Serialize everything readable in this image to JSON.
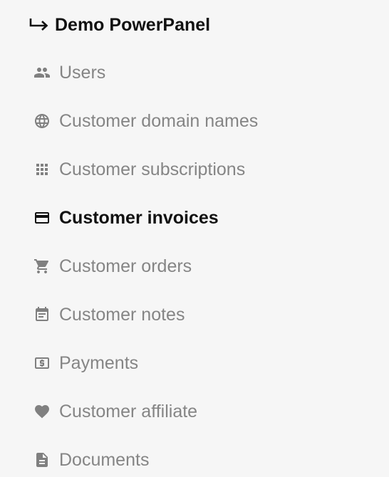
{
  "header": {
    "title": "Demo PowerPanel",
    "icon": "arrow-return-right-icon"
  },
  "nav": {
    "items": [
      {
        "label": "Users",
        "icon": "users-icon",
        "active": false
      },
      {
        "label": "Customer domain names",
        "icon": "globe-icon",
        "active": false
      },
      {
        "label": "Customer subscriptions",
        "icon": "grid-icon",
        "active": false
      },
      {
        "label": "Customer invoices",
        "icon": "credit-card-icon",
        "active": true
      },
      {
        "label": "Customer orders",
        "icon": "cart-icon",
        "active": false
      },
      {
        "label": "Customer notes",
        "icon": "notes-icon",
        "active": false
      },
      {
        "label": "Payments",
        "icon": "payment-icon",
        "active": false
      },
      {
        "label": "Customer affiliate",
        "icon": "heart-icon",
        "active": false
      },
      {
        "label": "Documents",
        "icon": "document-icon",
        "active": false
      }
    ]
  },
  "colors": {
    "background": "#f6f6f6",
    "active_text": "#111111",
    "inactive_text": "#858585"
  }
}
